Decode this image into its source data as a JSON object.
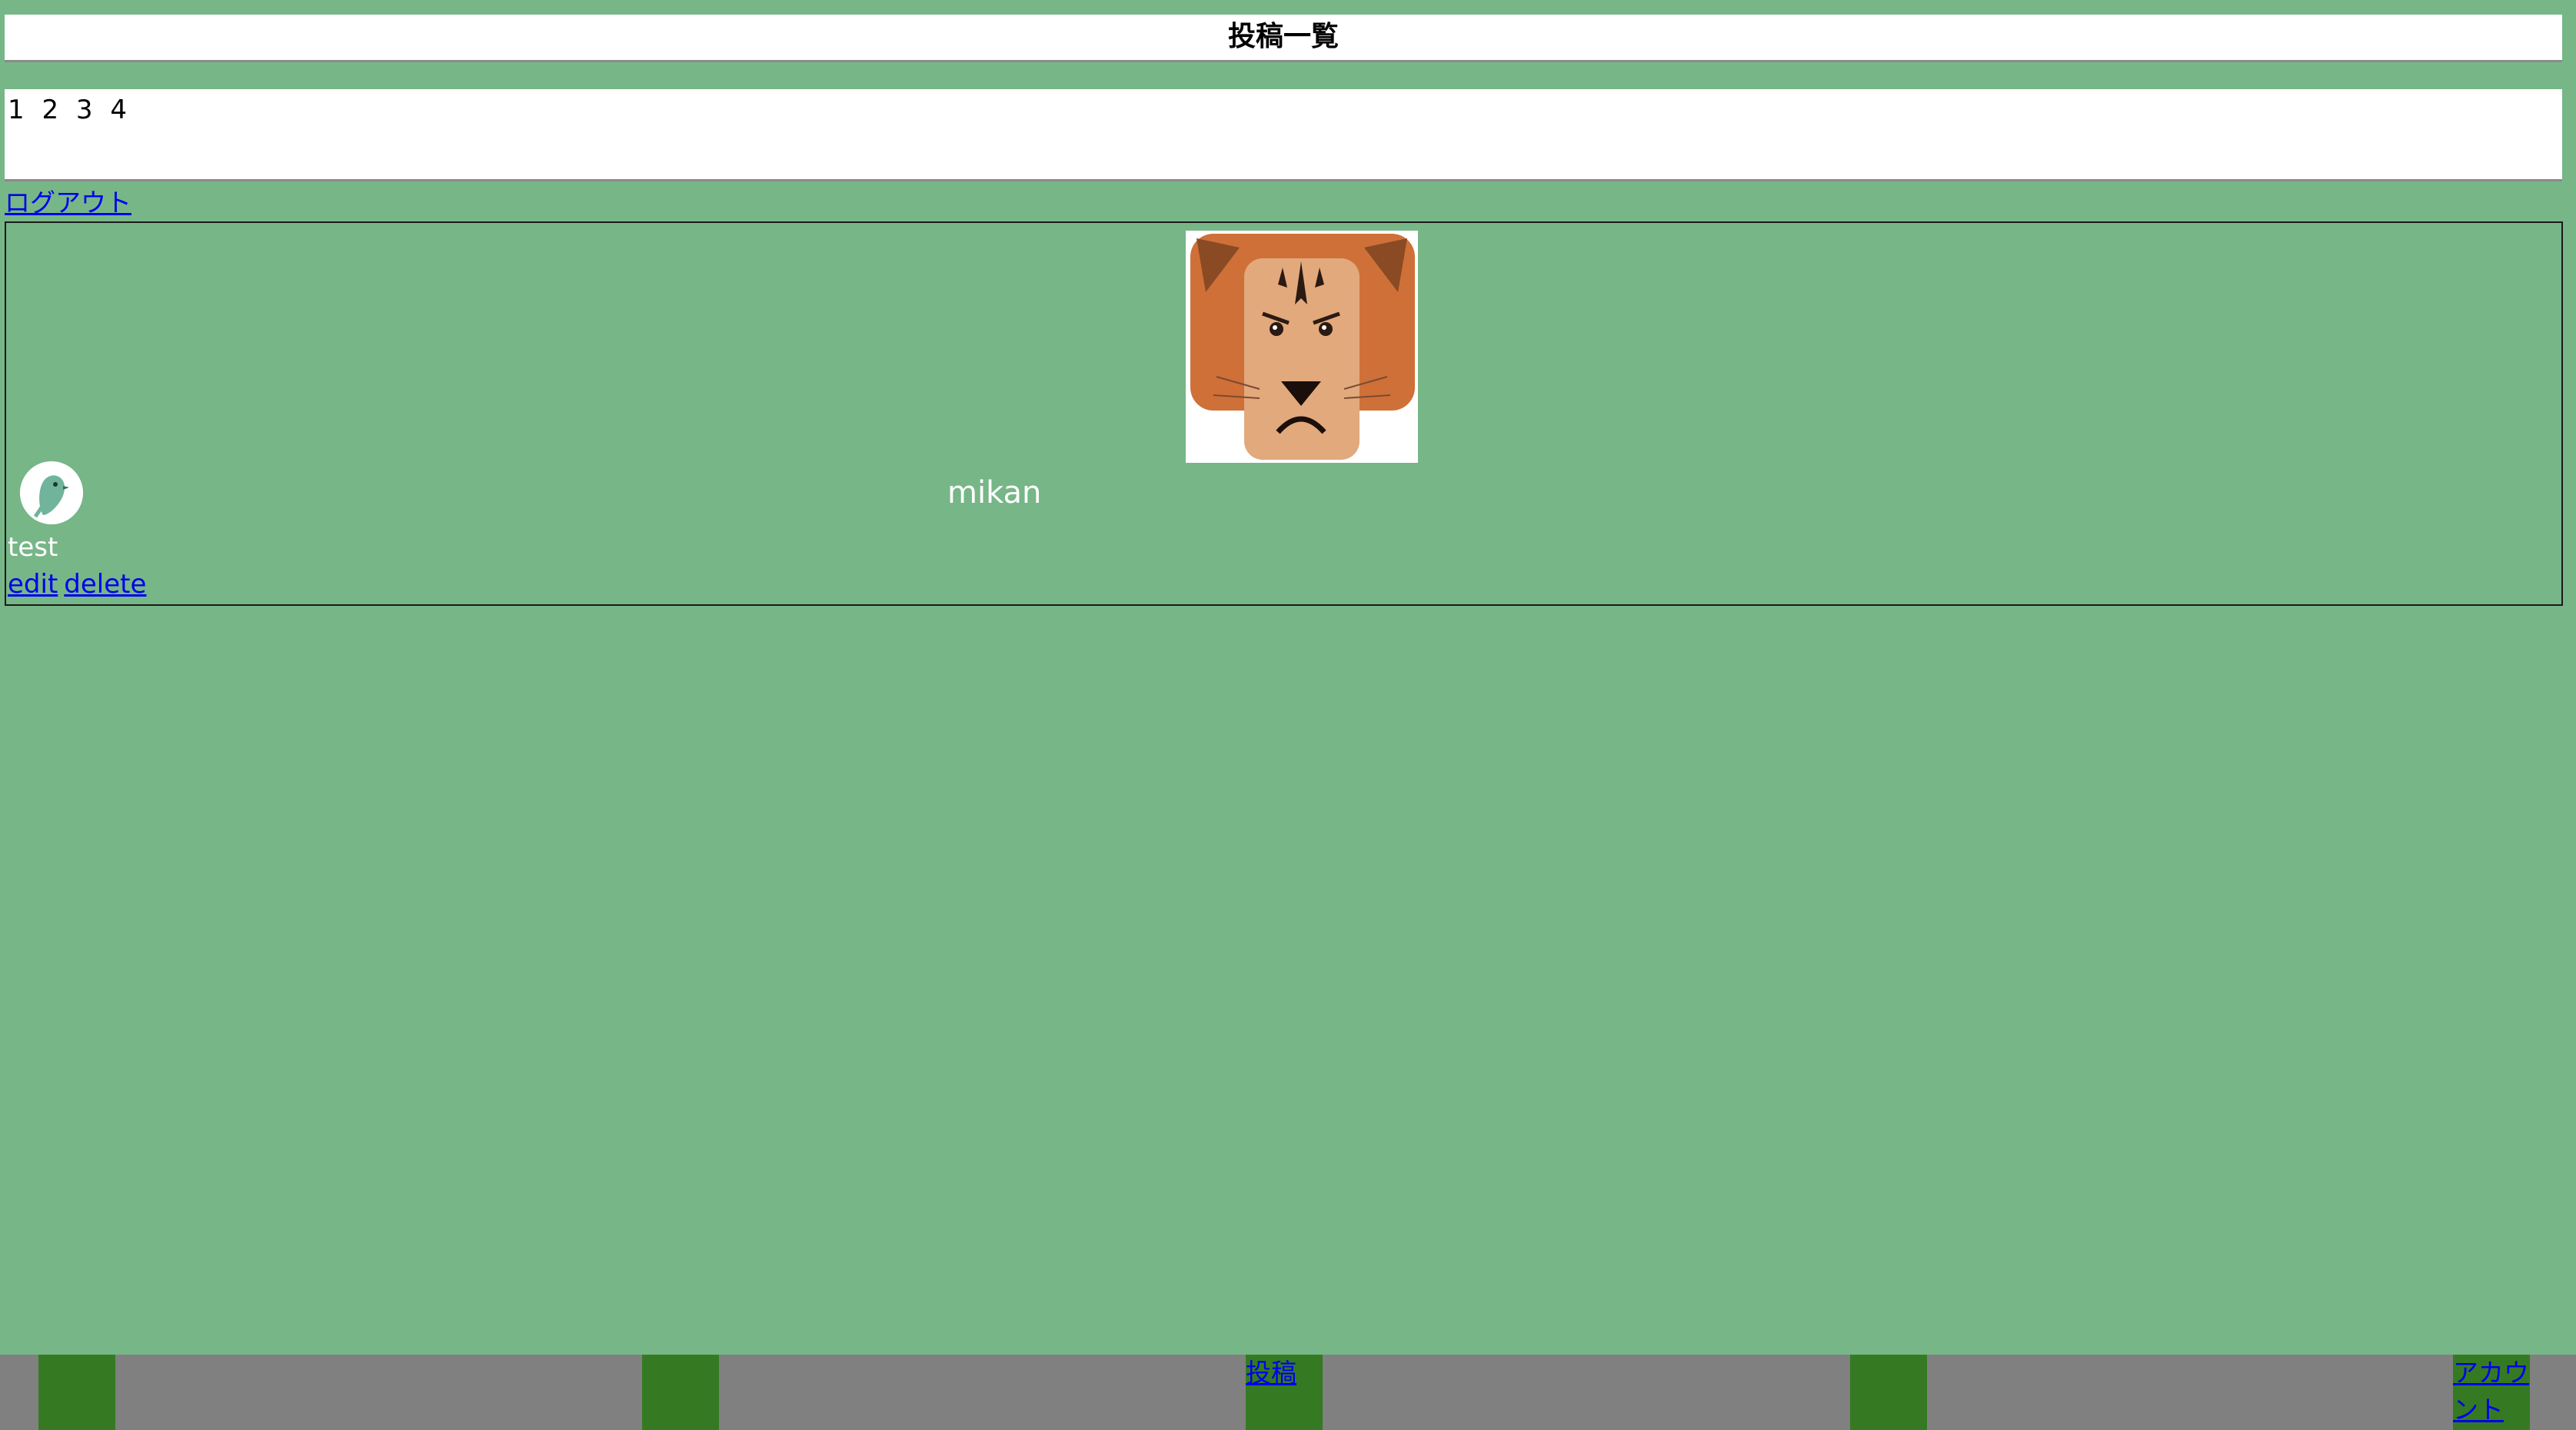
{
  "header": {
    "title": "投稿一覧"
  },
  "pagination": {
    "pages": [
      "1",
      "2",
      "3",
      "4"
    ]
  },
  "auth": {
    "logout_label": "ログアウト"
  },
  "post": {
    "username": "mikan",
    "body": "test",
    "edit_label": "edit",
    "delete_label": "delete",
    "image": "lion-face-illustration",
    "avatar": "bird-avatar"
  },
  "bottom_nav": {
    "items": [
      {
        "label": ""
      },
      {
        "label": ""
      },
      {
        "label": "投稿"
      },
      {
        "label": ""
      },
      {
        "label": "アカウント"
      }
    ]
  },
  "colors": {
    "background": "#77b687",
    "nav_bar": "#808080",
    "nav_item": "#357a22",
    "link": "#0000ee"
  }
}
